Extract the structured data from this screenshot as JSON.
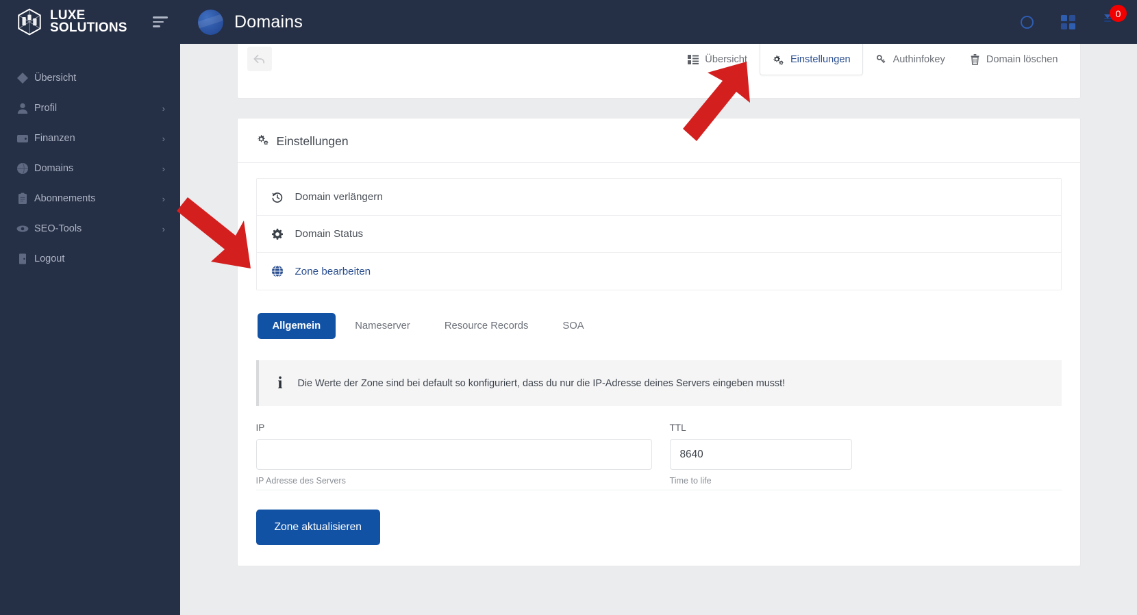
{
  "brand": {
    "line1": "LUXE",
    "line2": "SOLUTIONS"
  },
  "sidebar": {
    "items": [
      {
        "label": "Übersicht",
        "icon": "diamond-icon",
        "chevron": ""
      },
      {
        "label": "Profil",
        "icon": "user-icon",
        "chevron": "›"
      },
      {
        "label": "Finanzen",
        "icon": "wallet-icon",
        "chevron": "›"
      },
      {
        "label": "Domains",
        "icon": "globe-icon",
        "chevron": "›"
      },
      {
        "label": "Abonnements",
        "icon": "clipboard-icon",
        "chevron": "›"
      },
      {
        "label": "SEO-Tools",
        "icon": "eye-icon",
        "chevron": "›"
      },
      {
        "label": "Logout",
        "icon": "logout-door-icon",
        "chevron": ""
      }
    ]
  },
  "topbar": {
    "title": "Domains",
    "icons": [
      "circle-ring-icon",
      "apps-grid-icon",
      "chat-icon"
    ],
    "notification_count": "0"
  },
  "actionbar": {
    "back_icon": "back-arrow-icon",
    "tabs": [
      {
        "label": "Übersicht",
        "icon": "list-icon",
        "active": false
      },
      {
        "label": "Einstellungen",
        "icon": "cogs-icon",
        "active": true
      },
      {
        "label": "Authinfokey",
        "icon": "key-icon",
        "active": false
      },
      {
        "label": "Domain löschen",
        "icon": "trash-icon",
        "active": false
      }
    ]
  },
  "panel": {
    "title": "Einstellungen",
    "title_icon": "cogs-icon",
    "options": [
      {
        "label": "Domain verlängern",
        "icon": "history-icon",
        "active": false
      },
      {
        "label": "Domain Status",
        "icon": "gear-icon",
        "active": false
      },
      {
        "label": "Zone bearbeiten",
        "icon": "globe-icon",
        "active": true
      }
    ]
  },
  "zone": {
    "tabs": [
      {
        "label": "Allgemein",
        "active": true
      },
      {
        "label": "Nameserver",
        "active": false
      },
      {
        "label": "Resource Records",
        "active": false
      },
      {
        "label": "SOA",
        "active": false
      }
    ],
    "alert": {
      "icon": "info-icon",
      "message": "Die Werte der Zone sind bei default so konfiguriert, dass du nur die IP-Adresse deines Servers eingeben musst!"
    },
    "fields": {
      "ip": {
        "label": "IP",
        "value": "",
        "placeholder": "",
        "hint": "IP Adresse des Servers"
      },
      "ttl": {
        "label": "TTL",
        "value": "8640",
        "placeholder": "",
        "hint": "Time to life"
      }
    },
    "submit_label": "Zone aktualisieren"
  },
  "annotations": {
    "arrows": [
      {
        "name": "arrow-pointing-to-einstellungen-tab",
        "color": "#d41f1f"
      },
      {
        "name": "arrow-pointing-to-zone-bearbeiten",
        "color": "#d41f1f"
      }
    ]
  },
  "colors": {
    "sidebar_bg": "#252f45",
    "accent_blue": "#1252a5",
    "page_bg": "#ebecee",
    "badge_red": "#f20000",
    "arrow_red": "#d41f1f"
  }
}
